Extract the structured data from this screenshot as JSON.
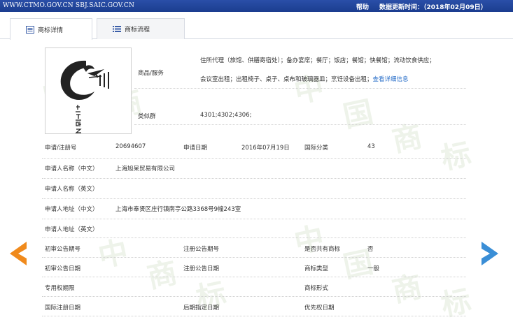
{
  "header": {
    "site": "WWW.CTMO.GOV.CN SBJ.SAIC.GOV.CN",
    "help": "帮助",
    "update_label": "数据更新时间：（2018年02月09日）"
  },
  "tabs": [
    {
      "label": "商标详情",
      "icon": "document-icon",
      "active": true
    },
    {
      "label": "商标流程",
      "icon": "list-icon",
      "active": false
    }
  ],
  "goods": {
    "label": "商品/服务",
    "line1": "住所代理（旅馆、供膳寄宿处）；备办宴席；餐厅；饭店；餐馆；快餐馆；流动饮食供应；",
    "line2": "会议室出租；出租椅子、桌子、桌布和玻璃器皿；烹饪设备出租；",
    "more_link": "查看详细信息"
  },
  "similar_group": {
    "label": "类似群",
    "value": "4301;4302;4306;"
  },
  "fields": {
    "reg_no_label": "申请/注册号",
    "reg_no": "20694607",
    "app_date_label": "申请日期",
    "app_date": "2016年07月19日",
    "intl_class_label": "国际分类",
    "intl_class": "43",
    "applicant_cn_label": "申请人名称（中文）",
    "applicant_cn": "上海旭呆贸易有限公司",
    "applicant_en_label": "申请人名称（英文）",
    "applicant_en": "",
    "address_cn_label": "申请人地址（中文）",
    "address_cn": "上海市奉贤区庄行镇南亭公路3368号9幢243室",
    "address_en_label": "申请人地址（英文）",
    "address_en": "",
    "prelim_no_label": "初审公告期号",
    "prelim_no": "",
    "reg_pub_no_label": "注册公告期号",
    "reg_pub_no": "",
    "shared_label": "是否共有商标",
    "shared": "否",
    "prelim_date_label": "初审公告日期",
    "prelim_date": "",
    "reg_pub_date_label": "注册公告日期",
    "reg_pub_date": "",
    "tm_type_label": "商标类型",
    "tm_type": "一般",
    "exclusive_label": "专用权期限",
    "exclusive": "",
    "tm_form_label": "商标形式",
    "tm_form": "",
    "intl_reg_date_label": "国际注册日期",
    "intl_reg_date": "",
    "later_date_label": "后期指定日期",
    "later_date": "",
    "priority_label": "优先权日期",
    "priority": ""
  },
  "watermark_chars": [
    "中",
    "国",
    "商",
    "标"
  ],
  "colors": {
    "header": "#1b3d8f",
    "link": "#2a6fc9",
    "arrow_left": "#f08a1c",
    "arrow_right": "#3a8ed6"
  }
}
